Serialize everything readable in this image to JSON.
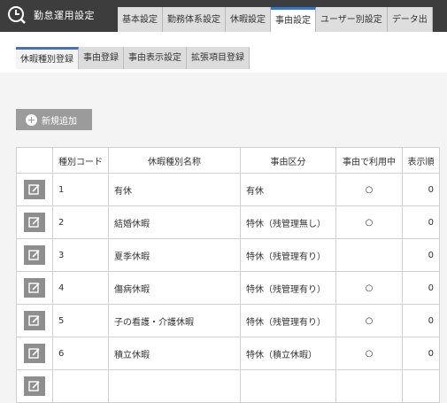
{
  "app": {
    "title": "勤怠運用設定"
  },
  "top_tabs": [
    {
      "label": "基本設定",
      "active": false
    },
    {
      "label": "勤務体系設定",
      "active": false
    },
    {
      "label": "休暇設定",
      "active": false
    },
    {
      "label": "事由設定",
      "active": true
    },
    {
      "label": "ユーザー別設定",
      "active": false
    },
    {
      "label": "データ出",
      "active": false
    }
  ],
  "sub_tabs": [
    {
      "label": "休暇種別登録",
      "active": true
    },
    {
      "label": "事由登録",
      "active": false
    },
    {
      "label": "事由表示設定",
      "active": false
    },
    {
      "label": "拡張項目登録",
      "active": false
    }
  ],
  "add_button": {
    "label": "新規追加",
    "icon": "plus-circle-icon"
  },
  "table": {
    "headers": [
      "",
      "種別コード",
      "休暇種別名称",
      "事由区分",
      "事由で利用中",
      "表示順"
    ],
    "rows": [
      {
        "code": "1",
        "name": "有休",
        "kubun": "有休",
        "in_use": "○",
        "order": "0"
      },
      {
        "code": "2",
        "name": "結婚休暇",
        "kubun": "特休（残管理無し）",
        "in_use": "○",
        "order": "0"
      },
      {
        "code": "3",
        "name": "夏季休暇",
        "kubun": "特休（残管理有り）",
        "in_use": "",
        "order": "0"
      },
      {
        "code": "4",
        "name": "傷病休暇",
        "kubun": "特休（残管理有り）",
        "in_use": "○",
        "order": "0"
      },
      {
        "code": "5",
        "name": "子の看護・介護休暇",
        "kubun": "特休（残管理有り）",
        "in_use": "○",
        "order": "0"
      },
      {
        "code": "6",
        "name": "積立休暇",
        "kubun": "特休（積立休暇）",
        "in_use": "○",
        "order": "0"
      },
      {
        "code": "",
        "name": "",
        "kubun": "",
        "in_use": "",
        "order": ""
      }
    ]
  },
  "colors": {
    "appbar": "#3d3d3d",
    "accent": "#3a74c5",
    "button": "#9b9b9b"
  }
}
